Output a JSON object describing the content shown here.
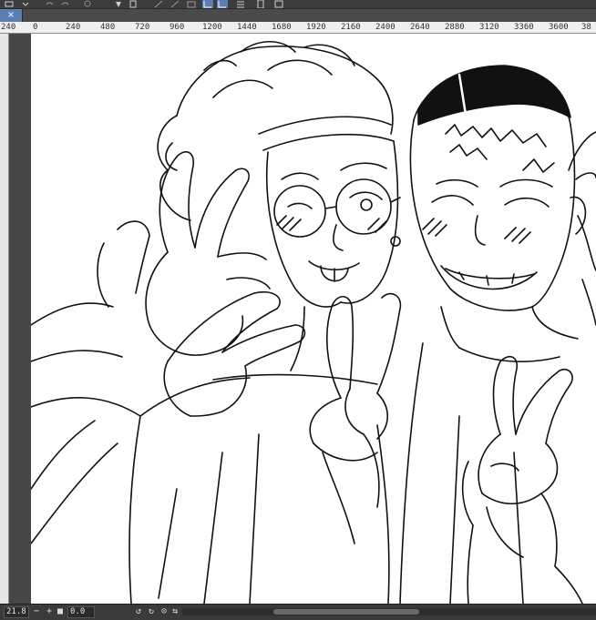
{
  "toolbar": {
    "icons": [
      "move-icon",
      "undo-icon",
      "redo-icon",
      "loading-icon",
      "fill-icon",
      "transform-icon",
      "select-icon",
      "grid-icon",
      "ruler-icon",
      "device-icon",
      "layers-icon"
    ]
  },
  "tab": {
    "close_label": "×"
  },
  "ruler": {
    "labels": [
      "240",
      "0",
      "240",
      "480",
      "720",
      "960",
      "1200",
      "1440",
      "1680",
      "1920",
      "2160",
      "2400",
      "2640",
      "2880",
      "3120",
      "3360",
      "3600",
      "38"
    ]
  },
  "status": {
    "zoom": "21.8",
    "angle": "0.0",
    "minus_label": "−",
    "plus_label": "+"
  },
  "colors": {
    "chrome": "#3d3d3d",
    "canvas": "#ffffff",
    "ruler": "#efefef",
    "accent": "#5b7fb3"
  }
}
